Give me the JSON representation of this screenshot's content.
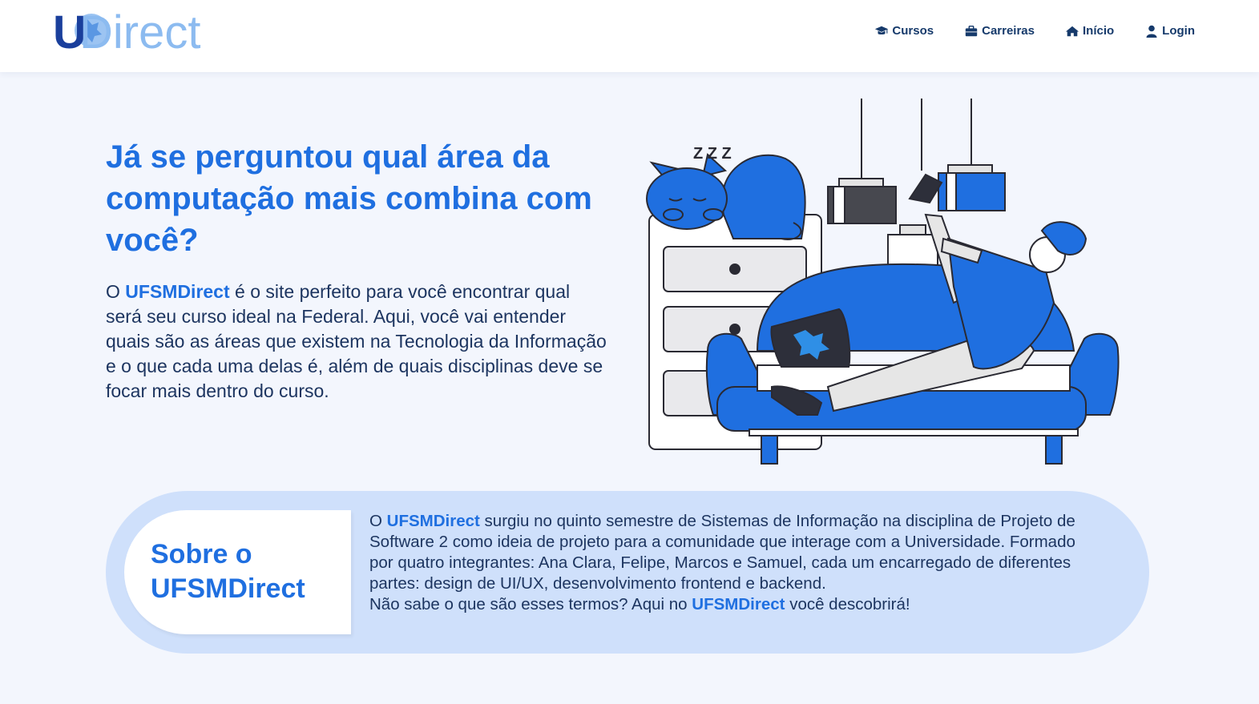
{
  "header": {
    "logo_text": "UDirect",
    "nav": [
      {
        "label": "Cursos",
        "icon": "graduation-cap-icon"
      },
      {
        "label": "Carreiras",
        "icon": "briefcase-icon"
      },
      {
        "label": "Início",
        "icon": "home-icon"
      },
      {
        "label": "Login",
        "icon": "user-icon"
      }
    ]
  },
  "hero": {
    "title": "Já se perguntou qual área da computação mais combina com você?",
    "text_prefix": "O",
    "brand": "UFSMDirect",
    "text_body": "é o site perfeito para você encontrar qual será seu curso ideal na Federal. Aqui, você vai entender quais são as áreas que existem na Tecnologia da Informação e o que cada uma delas é, além de quais disciplinas deve se focar mais dentro do curso.",
    "illustration_sleep_text": "Z Z Z"
  },
  "about": {
    "title": "Sobre o UFSMDirect",
    "p1_prefix": "O",
    "brand": "UFSMDirect",
    "p1_body": "surgiu no quinto semestre de Sistemas de Informação na disciplina de Projeto de Software 2 como ideia de projeto para a comunidade que interage com a Universidade. Formado por quatro integrantes: Ana Clara, Felipe, Marcos e Samuel, cada um encarregado de diferentes partes: design de UI/UX, desenvolvimento frontend e backend.",
    "p2_prefix": "Não sabe o que são esses termos? Aqui no",
    "p2_suffix": "você descobrirá!"
  },
  "colors": {
    "accent": "#1f6fe0",
    "navy": "#163a6b",
    "background": "#f3f6fd",
    "card": "#cfe0fb"
  }
}
